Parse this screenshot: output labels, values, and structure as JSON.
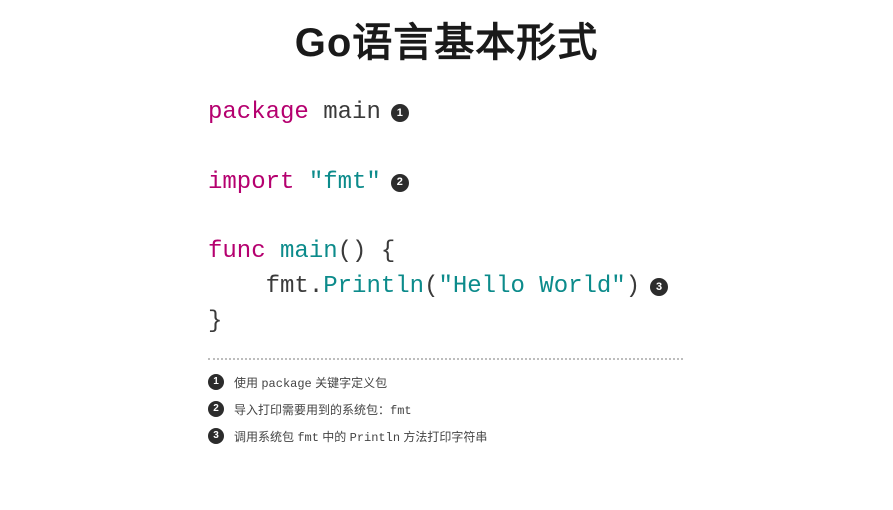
{
  "title": "Go语言基本形式",
  "code": {
    "line1": {
      "kw": "package",
      "ident": " main",
      "marker": "1"
    },
    "line2": {
      "kw": "import",
      "str": " \"fmt\"",
      "marker": "2"
    },
    "line3": {
      "kw": "func",
      "ident": " main",
      "plain": "() {"
    },
    "line4": {
      "indent": "    ",
      "obj": "fmt",
      "dot": ".",
      "method": "Println",
      "lparen": "(",
      "str": "\"Hello World\"",
      "rparen": ")",
      "marker": "3"
    },
    "line5": {
      "plain": "}"
    }
  },
  "notes": [
    {
      "num": "1",
      "pre": "使用 ",
      "mono": "package",
      "post": " 关键字定义包"
    },
    {
      "num": "2",
      "pre": "导入打印需要用到的系统包：",
      "mono": "fmt",
      "post": ""
    },
    {
      "num": "3",
      "pre": "调用系统包 ",
      "mono": "fmt",
      "mid": " 中的 ",
      "mono2": "Println",
      "post": " 方法打印字符串"
    }
  ]
}
